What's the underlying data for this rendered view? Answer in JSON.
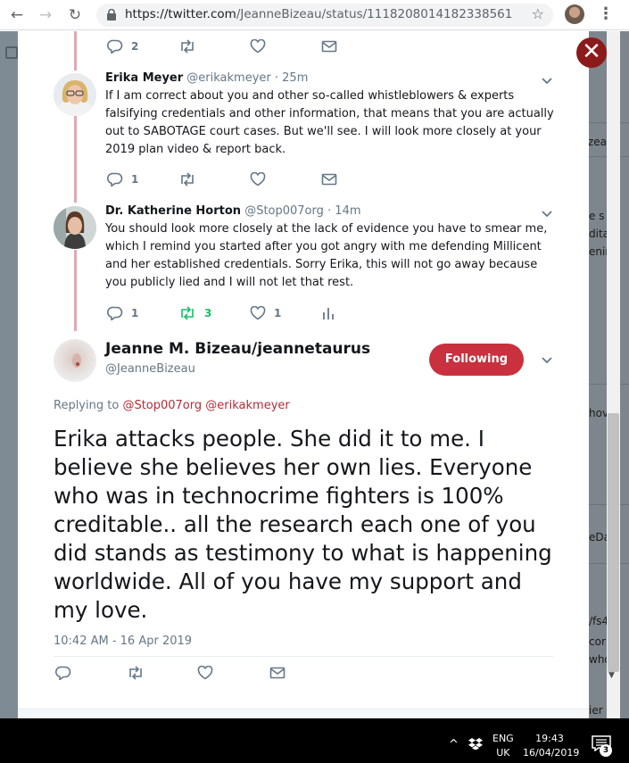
{
  "browser": {
    "url_host": "https://twitter.com",
    "url_path": "/JeanneBizeau/status/1118208014182338561"
  },
  "background_fragments": [
    "zea",
    "e s",
    "dita",
    "enin",
    "hov",
    "eDa",
    "/fs4",
    "cor",
    "who",
    "ier"
  ],
  "replies": [
    {
      "name": "Erika Meyer",
      "handle": "@erikakmeyer",
      "time": "· 25m",
      "text": "If I am correct about you and other so-called whistleblowers & experts falsifying credentials and other information, that means that you are actually out to SABOTAGE court cases. But we'll see. I will look more closely at your 2019 plan video & report back.",
      "reply_count": "1",
      "retweet_count": "",
      "like_count": ""
    },
    {
      "name": "Dr. Katherine Horton",
      "handle": "@Stop007org",
      "time": "· 14m",
      "text": "You should look more closely at the lack of evidence you have to smear me, which I remind you started after you got angry with me defending Millicent and her established credentials. Sorry Erika, this will not go away because you publicly lied and I will not let that rest.",
      "reply_count": "1",
      "retweet_count": "3",
      "like_count": "1"
    }
  ],
  "top_actions": {
    "reply_count": "2"
  },
  "main_tweet": {
    "name": "Jeanne M. Bizeau/jeannetaurus",
    "handle": "@JeanneBizeau",
    "follow_label": "Following",
    "replying_prefix": "Replying to",
    "mention_1": "@Stop007org",
    "mention_2": "@erikakmeyer",
    "text": "Erika attacks people. She did it to me. I believe she believes her own lies. Everyone who was in technocrime fighters is 100% creditable.. all the research each one of you did stands as testimony to what is happening worldwide. All of you have my support and my love.",
    "timestamp": "10:42 AM - 16 Apr 2019"
  },
  "taskbar": {
    "lang_1": "ENG",
    "lang_2": "UK",
    "time": "19:43",
    "date": "16/04/2019",
    "notification_count": "3"
  },
  "colors": {
    "accent_red": "#c8313d",
    "thread_line": "#e0a8b3",
    "retweet_green": "#17bf63"
  }
}
